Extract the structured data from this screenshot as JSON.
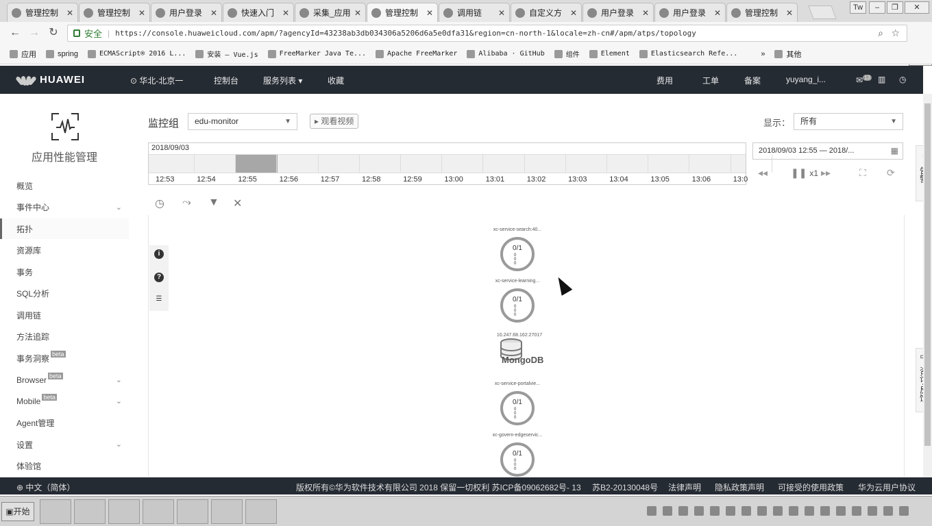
{
  "browser": {
    "tabs": [
      {
        "label": "管理控制"
      },
      {
        "label": "管理控制"
      },
      {
        "label": "用户登录"
      },
      {
        "label": "快速入门"
      },
      {
        "label": "采集_应用"
      },
      {
        "label": "管理控制"
      },
      {
        "label": "调用链"
      },
      {
        "label": "自定义方"
      },
      {
        "label": "用户登录"
      },
      {
        "label": "用户登录"
      },
      {
        "label": "管理控制"
      }
    ],
    "active_tab": 5,
    "secure_label": "安全",
    "url": "https://console.huaweicloud.com/apm/?agencyId=43238ab3db034306a5206d6a5e0dfa31&region=cn-north-1&locale=zh-cn#/apm/atps/topology",
    "user_badge": "Tw",
    "side_tab": "开始",
    "bookmarks": [
      {
        "label": "应用"
      },
      {
        "label": "spring"
      },
      {
        "label": "ECMAScript® 2016 L..."
      },
      {
        "label": "安装 — Vue.js"
      },
      {
        "label": "FreeMarker Java Te..."
      },
      {
        "label": "Apache FreeMarker"
      },
      {
        "label": "Alibaba · GitHub"
      },
      {
        "label": "组件"
      },
      {
        "label": "Element"
      },
      {
        "label": "Elasticsearch Refe..."
      }
    ],
    "bookmarks_more": "»",
    "other_bookmarks": "其他"
  },
  "header": {
    "brand": "HUAWEI",
    "region": "华北-北京一",
    "nav": [
      "控制台",
      "服务列表",
      "收藏"
    ],
    "right": [
      "费用",
      "工单",
      "备案",
      "yuyang_i..."
    ],
    "mail_count": "13"
  },
  "sidenav": {
    "title": "应用性能管理",
    "items": [
      {
        "label": "概览",
        "chevron": false,
        "beta": false
      },
      {
        "label": "事件中心",
        "chevron": true,
        "beta": false
      },
      {
        "label": "拓扑",
        "chevron": false,
        "beta": false,
        "active": true
      },
      {
        "label": "资源库",
        "chevron": false,
        "beta": false
      },
      {
        "label": "事务",
        "chevron": false,
        "beta": false
      },
      {
        "label": "SQL分析",
        "chevron": false,
        "beta": false
      },
      {
        "label": "调用链",
        "chevron": false,
        "beta": false
      },
      {
        "label": "方法追踪",
        "chevron": false,
        "beta": false
      },
      {
        "label": "事务洞察",
        "chevron": false,
        "beta": true
      },
      {
        "label": "Browser",
        "chevron": true,
        "beta": true
      },
      {
        "label": "Mobile",
        "chevron": true,
        "beta": true
      },
      {
        "label": "Agent管理",
        "chevron": false,
        "beta": false
      },
      {
        "label": "设置",
        "chevron": true,
        "beta": false
      },
      {
        "label": "体验馆",
        "chevron": false,
        "beta": false
      }
    ],
    "beta_label": "beta"
  },
  "toolbar": {
    "group_label": "监控组",
    "group_value": "edu-monitor",
    "video_label": "观看视频",
    "display_label": "显示：",
    "display_value": "所有"
  },
  "timeline": {
    "date": "2018/09/03",
    "ticks": [
      "12:53",
      "12:54",
      "12:55",
      "12:56",
      "12:57",
      "12:58",
      "12:59",
      "13:00",
      "13:01",
      "13:02",
      "13:03",
      "13:04",
      "13:05",
      "13:06",
      "13:0"
    ],
    "range": "2018/09/03 12:55 — 2018/...",
    "speed": "x1"
  },
  "topology": {
    "nodes": [
      {
        "name": "xc-service-search:40...",
        "count": "0/1"
      },
      {
        "name": "xc-service-learning...",
        "count": "0/1"
      },
      {
        "name": "xc-service-portalvie...",
        "count": "0/1"
      },
      {
        "name": "xc-govern-edgeservic...",
        "count": "0/1"
      }
    ],
    "db": {
      "address": "10.247.68.162:27017",
      "name": "MongoDB"
    },
    "mini_rows": [
      "0",
      "0",
      "0"
    ]
  },
  "right_panel": {
    "alert": "告警",
    "feedback": "咨询·反馈"
  },
  "footer": {
    "lang": "中文（简体）",
    "copyright": "版权所有©华为软件技术有限公司 2018 保留一切权利 苏ICP备09062682号- 13",
    "icp": "苏B2-20130048号",
    "links": [
      "法律声明",
      "隐私政策声明",
      "可接受的使用政策",
      "华为云用户协议"
    ]
  },
  "taskbar": {
    "start": "开始"
  }
}
